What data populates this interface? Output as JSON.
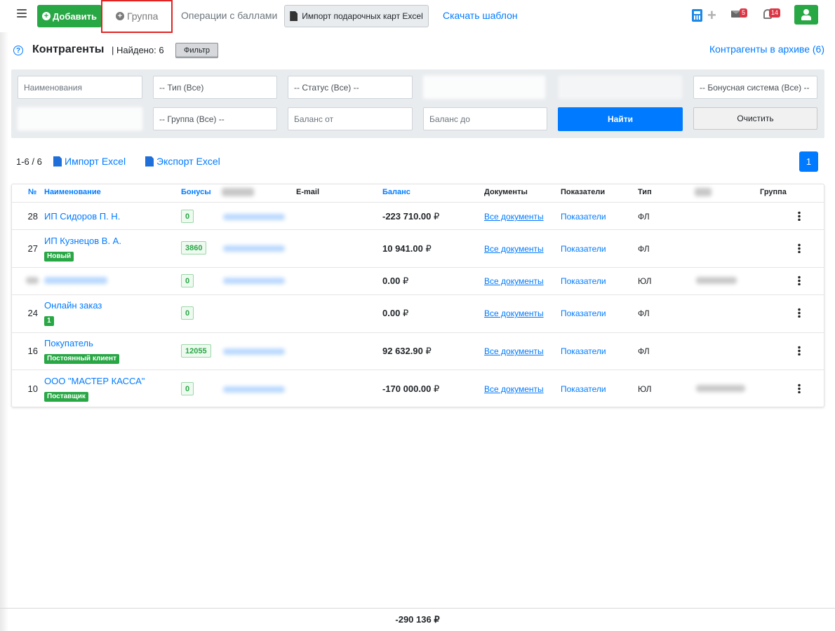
{
  "header": {
    "add_label": "Добавить",
    "group_label": "Группа",
    "points_label": "Операции с баллами",
    "import_cards_label": "Импорт подарочных карт Excel",
    "template_label": "Скачать шаблон",
    "mail_count": "5",
    "notif_count": "14"
  },
  "title_row": {
    "title": "Контрагенты",
    "found": "| Найдено: 6",
    "filter_label": "Фильтр",
    "archive_link": "Контрагенты в архиве (6)"
  },
  "filters": {
    "name_placeholder": "Наименования",
    "type_value": "-- Тип (Все)",
    "status_value": "-- Статус (Все) --",
    "bonus_value": "-- Бонусная система (Все) --",
    "group_value": "-- Группа (Все) --",
    "balance_from": "Баланс от",
    "balance_to": "Баланс до",
    "find_label": "Найти",
    "clear_label": "Очистить"
  },
  "list": {
    "range": "1-6 / 6",
    "import_label": "Импорт Excel",
    "export_label": "Экспорт Excel",
    "page": "1"
  },
  "table": {
    "headers": {
      "num": "№",
      "name": "Наименование",
      "bonuses": "Бонусы",
      "email": "E-mail",
      "balance": "Баланс",
      "docs": "Документы",
      "stats": "Показатели",
      "type": "Тип",
      "group": "Группа"
    },
    "rows": [
      {
        "num": "28",
        "name": "ИП Сидоров П. Н.",
        "tag": "",
        "bonus": "0",
        "balance": "-223 710.00",
        "currency": "₽",
        "docs": "Все документы",
        "stats": "Показатели",
        "type": "ФЛ"
      },
      {
        "num": "27",
        "name": "ИП Кузнецов В. А.",
        "tag": "Новый",
        "bonus": "3860",
        "balance": "10 941.00",
        "currency": "₽",
        "docs": "Все документы",
        "stats": "Показатели",
        "type": "ФЛ"
      },
      {
        "num": "",
        "name": "",
        "tag": "",
        "bonus": "0",
        "balance": "0.00",
        "currency": "₽",
        "docs": "Все документы",
        "stats": "Показатели",
        "type": "ЮЛ"
      },
      {
        "num": "24",
        "name": "Онлайн заказ",
        "tag": "1",
        "bonus": "0",
        "balance": "0.00",
        "currency": "₽",
        "docs": "Все документы",
        "stats": "Показатели",
        "type": "ФЛ"
      },
      {
        "num": "16",
        "name": "Покупатель",
        "tag": "Постоянный клиент",
        "bonus": "12055",
        "balance": "92 632.90",
        "currency": "₽",
        "docs": "Все документы",
        "stats": "Показатели",
        "type": "ФЛ"
      },
      {
        "num": "10",
        "name": "ООО \"МАСТЕР КАССА\"",
        "tag": "Поставщик",
        "bonus": "0",
        "balance": "-170 000.00",
        "currency": "₽",
        "docs": "Все документы",
        "stats": "Показатели",
        "type": "ЮЛ"
      }
    ]
  },
  "footer": {
    "total": "-290 136 ₽"
  },
  "colors": {
    "primary": "#007bff",
    "success": "#28a745",
    "danger": "#dc3545",
    "highlight": "#e02424"
  },
  "icons": [
    "menu-icon",
    "plus-circle-icon",
    "file-import-icon",
    "calculator-icon",
    "plus-icon",
    "envelope-icon",
    "bell-icon",
    "user-icon",
    "help-icon",
    "file-export-icon",
    "dots-vertical-icon"
  ]
}
